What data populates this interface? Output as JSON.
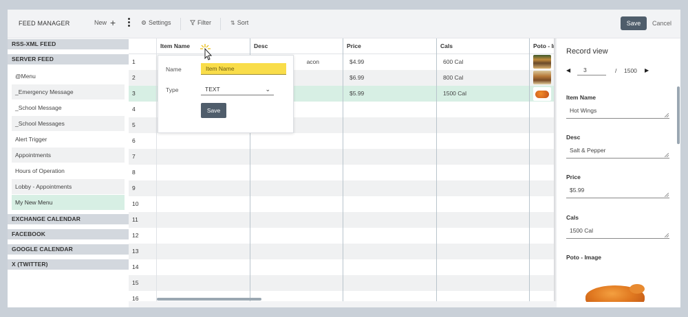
{
  "app": {
    "title": "FEED MANAGER"
  },
  "toolbar": {
    "new_label": "New",
    "settings_label": "Settings",
    "filter_label": "Filter",
    "sort_label": "Sort",
    "save_label": "Save",
    "cancel_label": "Cancel"
  },
  "sidebar": {
    "groups": {
      "rss": "RSS-XML FEED",
      "server": "SERVER FEED",
      "exchange": "EXCHANGE CALENDAR",
      "facebook": "FACEBOOK",
      "google": "GOOGLE CALENDAR",
      "twitter": "X (TWITTER)"
    },
    "items": [
      "@Menu",
      "_Emergency Message",
      "_School Message",
      "_School Messages",
      "Alert Trigger",
      "Appointments",
      "Hours of Operation",
      "Lobby - Appointments",
      "My New Menu"
    ],
    "active_item": "My New Menu"
  },
  "grid": {
    "columns": [
      "Item Name",
      "Desc",
      "Price",
      "Cals",
      "Poto - Image"
    ],
    "row_numbers": [
      "1",
      "2",
      "3",
      "4",
      "5",
      "6",
      "7",
      "8",
      "9",
      "10",
      "11",
      "12",
      "13",
      "14",
      "15",
      "16"
    ],
    "rows": [
      {
        "desc": "acon",
        "price": "$4.99",
        "cals": "600 Cal"
      },
      {
        "price": "$6.99",
        "cals": "800 Cal"
      },
      {
        "price": "$5.99",
        "cals": "1500 Cal"
      }
    ],
    "selected_row": 3
  },
  "column_popup": {
    "name_label": "Name",
    "name_value": "Item Name",
    "type_label": "Type",
    "type_value": "TEXT",
    "save_label": "Save"
  },
  "record_view": {
    "title": "Record view",
    "current": "3",
    "separator": "/",
    "total": "1500",
    "fields": [
      {
        "label": "Item Name",
        "value": "Hot Wings"
      },
      {
        "label": "Desc",
        "value": "Salt & Pepper"
      },
      {
        "label": "Price",
        "value": "$5.99"
      },
      {
        "label": "Cals",
        "value": "1500 Cal"
      }
    ],
    "image_label": "Poto - Image"
  },
  "colors": {
    "accent_button": "#4f5d6b",
    "selected_row": "#d7efe4",
    "highlight_input": "#f9dd4a",
    "group_header": "#d3d8de"
  }
}
